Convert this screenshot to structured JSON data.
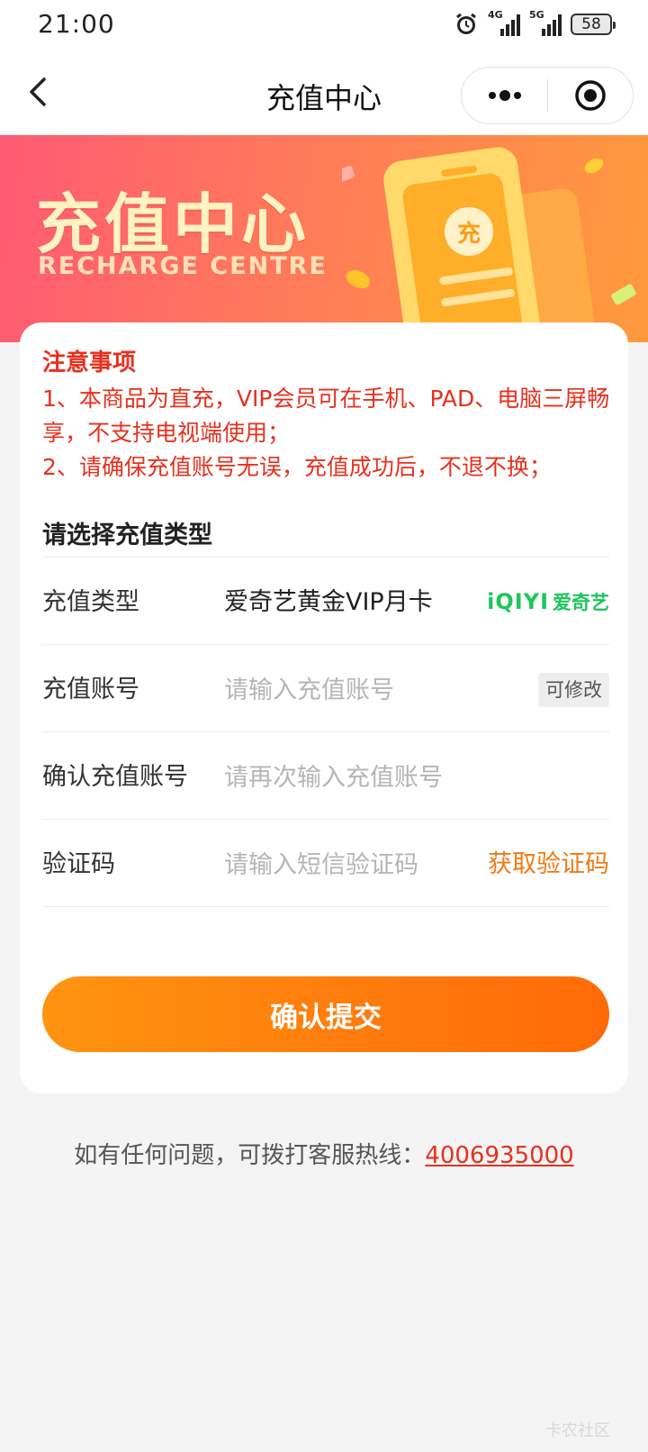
{
  "status_bar": {
    "time": "21:00",
    "network_1": "4G",
    "network_2": "5G",
    "battery": "58"
  },
  "nav": {
    "title": "充值中心",
    "back_icon": "chevron-left-icon",
    "more_icon": "more-dots-icon",
    "close_icon": "target-close-icon"
  },
  "banner": {
    "title": "充值中心",
    "subtitle": "RECHARGE CENTRE",
    "badge_char": "充"
  },
  "notice": {
    "title": "注意事项",
    "line1": "1、本商品为直充，VIP会员可在手机、PAD、电脑三屏畅享，不支持电视端使用；",
    "line2": "2、请确保充值账号无误，充值成功后，不退不换；"
  },
  "form": {
    "section_title": "请选择充值类型",
    "type_label": "充值类型",
    "type_value": "爱奇艺黄金VIP月卡",
    "logo_en": "iQIYI",
    "logo_zh": "爱奇艺",
    "account_label": "充值账号",
    "account_placeholder": "请输入充值账号",
    "editable_tag": "可修改",
    "confirm_label": "确认充值账号",
    "confirm_placeholder": "请再次输入充值账号",
    "code_label": "验证码",
    "code_placeholder": "请输入短信验证码",
    "get_code": "获取验证码",
    "submit": "确认提交"
  },
  "footer": {
    "service_text": "如有任何问题，可拨打客服热线：",
    "service_phone": "4006935000",
    "watermark": "卡农社区"
  },
  "colors": {
    "accent_orange": "#ff7a0c",
    "warning_red": "#e8301e",
    "iqiyi_green": "#1ec65a"
  }
}
